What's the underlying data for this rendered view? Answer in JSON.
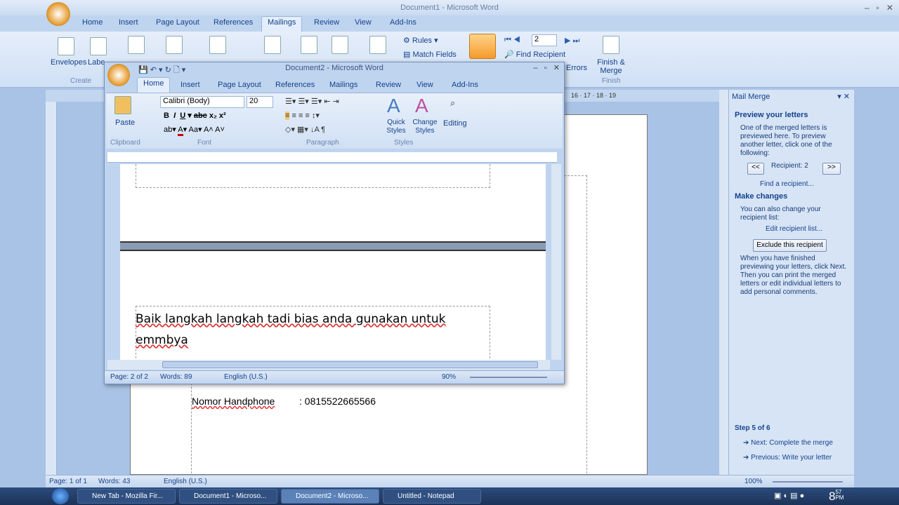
{
  "doc1": {
    "title": "Document1 - Microsoft Word",
    "tabs": [
      "Home",
      "Insert",
      "Page Layout",
      "References",
      "Mailings",
      "Review",
      "View",
      "Add-Ins"
    ],
    "active_tab": "Mailings",
    "ribbon": {
      "envelopes": "Envelopes",
      "labels": "Labe",
      "create": "Create",
      "rules": "Rules",
      "match_fields": "Match Fields",
      "record": "2",
      "find_recipient": "Find Recipient",
      "errors": "Errors",
      "finish_merge": "Finish & Merge",
      "finish": "Finish"
    },
    "ruler_marks": [
      "16",
      "17",
      "18",
      "19"
    ],
    "body": {
      "label": "Nomor Handphone",
      "value": ": 0815522665566"
    },
    "status": {
      "page": "Page: 1 of 1",
      "words": "Words: 43",
      "language": "English (U.S.)",
      "zoom": "100%"
    }
  },
  "doc2": {
    "title": "Document2 - Microsoft Word",
    "tabs": [
      "Home",
      "Insert",
      "Page Layout",
      "References",
      "Mailings",
      "Review",
      "View",
      "Add-Ins"
    ],
    "active_tab": "Home",
    "ribbon": {
      "paste": "Paste",
      "clipboard": "Clipboard",
      "font_name": "Calibri (Body)",
      "font_size": "20",
      "font": "Font",
      "paragraph": "Paragraph",
      "quick_styles": "Quick Styles",
      "change_styles": "Change Styles",
      "styles": "Styles",
      "editing": "Editing"
    },
    "body_line1": "Baik langkah langkah tadi bias anda gunakan untuk",
    "body_line2": "emmbya",
    "status": {
      "page": "Page: 2 of 2",
      "words": "Words: 89",
      "language": "English (U.S.)",
      "zoom": "90%"
    }
  },
  "mail_merge": {
    "title": "Mail Merge",
    "preview_heading": "Preview your letters",
    "preview_text": "One of the merged letters is previewed here. To preview another letter, click one of the following:",
    "prev": "<<",
    "recipient": "Recipient: 2",
    "next": ">>",
    "find": "Find a recipient...",
    "changes_heading": "Make changes",
    "changes_text": "You can also change your recipient list:",
    "edit_list": "Edit recipient list...",
    "exclude": "Exclude this recipient",
    "finish_text": "When you have finished previewing your letters, click Next. Then you can print the merged letters or edit individual letters to add personal comments.",
    "step": "Step 5 of 6",
    "next_step": "Next: Complete the merge",
    "prev_step": "Previous: Write your letter"
  },
  "taskbar": {
    "items": [
      "New Tab - Mozilla Fir...",
      "Document1 - Microso...",
      "Document2 - Microso...",
      "Untitled - Notepad"
    ],
    "active": 2,
    "clock_hour": "8",
    "clock_min": "57",
    "clock_ampm": "PM"
  }
}
